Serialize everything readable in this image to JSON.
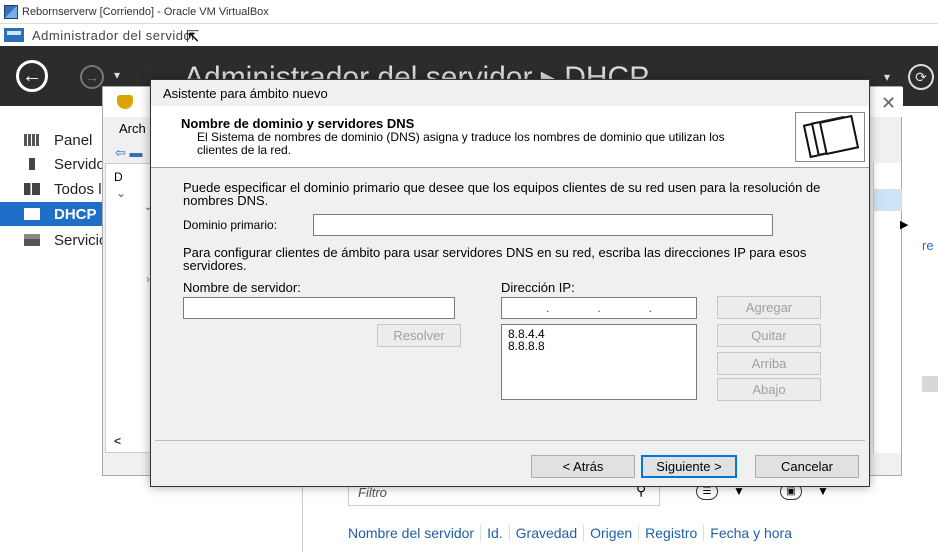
{
  "vbox": {
    "title": "Rebornserverw [Corriendo] - Oracle VM VirtualBox"
  },
  "app": {
    "title": "Administrador del servidor"
  },
  "header": {
    "breadcrumb": "Administrador del servidor ▸ DHCP",
    "back_glyph": "←",
    "forward_glyph": "→",
    "dropdown_glyph": "▾",
    "refresh_glyph": "⟳"
  },
  "sidebar": {
    "items": [
      {
        "label": "Panel",
        "icon": "dashboard-icon",
        "active": false
      },
      {
        "label": "Servidor local",
        "icon": "server-icon",
        "active": false
      },
      {
        "label": "Todos los servidores",
        "icon": "servers-icon",
        "active": false
      },
      {
        "label": "DHCP",
        "icon": "dhcp-icon",
        "active": true
      },
      {
        "label": "Servicios de archivos",
        "icon": "file-services-icon",
        "active": false
      }
    ]
  },
  "mmc": {
    "menu_archivo": "Arch",
    "tree_root": "D",
    "scroll_left": "<",
    "close": "✕",
    "re_text": "re"
  },
  "wizard": {
    "title": "Asistente para ámbito nuevo",
    "heading": "Nombre de dominio y servidores DNS",
    "description": "El Sistema de nombres de dominio (DNS) asigna y traduce los nombres de dominio que utilizan los clientes de la red.",
    "text_domain": "Puede especificar el dominio primario que desee que los equipos clientes de su red usen para la resolución de nombres DNS.",
    "domain_label": "Dominio primario:",
    "domain_value": "",
    "text_dns": "Para configurar clientes de ámbito para usar servidores DNS en su red, escriba las direcciones IP para esos servidores.",
    "server_name_label": "Nombre de servidor:",
    "server_name_value": "",
    "ip_label": "Dirección IP:",
    "ip_dots": [
      ".",
      ".",
      "."
    ],
    "ip_list": [
      "8.8.4.4",
      "8.8.8.8"
    ],
    "buttons": {
      "resolver": "Resolver",
      "agregar": "Agregar",
      "quitar": "Quitar",
      "arriba": "Arriba",
      "abajo": "Abajo",
      "atras": "< Atrás",
      "siguiente": "Siguiente >",
      "cancelar": "Cancelar"
    }
  },
  "events": {
    "filter_placeholder": "Filtro",
    "columns": [
      "Nombre del servidor",
      "Id.",
      "Gravedad",
      "Origen",
      "Registro",
      "Fecha y hora"
    ]
  },
  "colors": {
    "accent": "#1f6fc9",
    "header_bg": "#2c2c2c",
    "dialog_bg": "#f0f0f0"
  }
}
